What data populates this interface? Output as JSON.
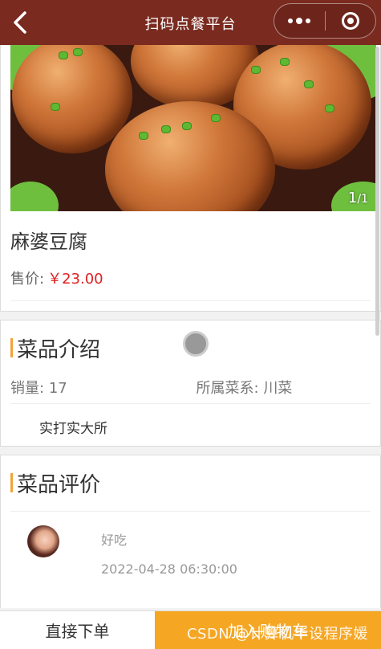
{
  "navbar": {
    "title": "扫码点餐平台",
    "back_icon": "chevron-left-icon",
    "more_icon": "more-dots-icon",
    "capsule_icon": "target-icon",
    "bg_color": "#7a2a1f"
  },
  "dish": {
    "image_counter_current": "1",
    "image_counter_total": "/1",
    "name": "麻婆豆腐",
    "price_label": "售价:",
    "price_value": "￥23.00",
    "price_color": "#e02020"
  },
  "intro": {
    "title": "菜品介绍",
    "sales_label": "销量:",
    "sales_value": "17",
    "category_label": "所属菜系:",
    "category_value": "川菜",
    "description": "实打实大所"
  },
  "reviews": {
    "title": "菜品评价",
    "items": [
      {
        "text": "好吃",
        "time": "2022-04-28 06:30:00"
      }
    ]
  },
  "bottom_bar": {
    "order_label": "直接下单",
    "cart_label": "加入购物车",
    "watermark": "CSDN @计算机毕设程序媛",
    "accent_color": "#f5a623"
  }
}
